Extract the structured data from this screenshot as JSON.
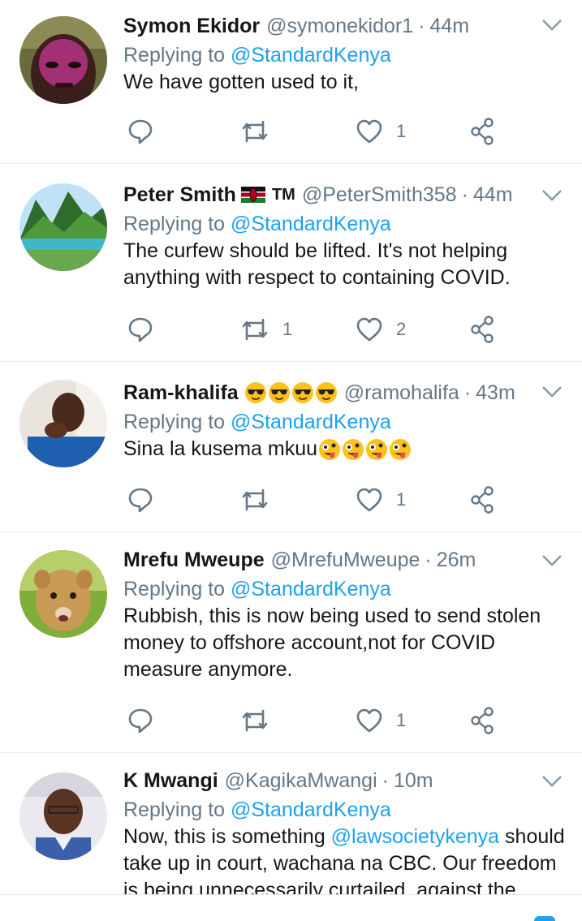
{
  "reply_prefix": "Replying to",
  "tweets": [
    {
      "name": "Symon Ekidor",
      "handle": "@symonekidor1",
      "separator": "·",
      "time": "44m",
      "reply_to": "@StandardKenya",
      "text": "We have gotten used to it,",
      "reply_count": "",
      "retweet_count": "",
      "like_count": "1",
      "avatar": "portrait-dark-face"
    },
    {
      "name": "Peter Smith",
      "badge": "kenya-flag-emoji",
      "tm": "TM",
      "handle": "@PeterSmith358",
      "separator": "·",
      "time": "44m",
      "reply_to": "@StandardKenya",
      "text": "The curfew should be lifted. It's not helping anything with respect to containing COVID.",
      "reply_count": "",
      "retweet_count": "1",
      "like_count": "2",
      "avatar": "mountain-lake-landscape"
    },
    {
      "name": "Ram-khalifa",
      "badge": "sunglasses-emoji x4",
      "handle": "@ramohalifa",
      "separator": "·",
      "time": "43m",
      "reply_to": "@StandardKenya",
      "text": "Sina la kusema mkuu",
      "text_emoji": "zany-face-emoji x4",
      "reply_count": "",
      "retweet_count": "",
      "like_count": "1",
      "avatar": "man-blue-shirt"
    },
    {
      "name": "Mrefu Mweupe",
      "handle": "@MrefuMweupe",
      "separator": "·",
      "time": "26m",
      "reply_to": "@StandardKenya",
      "text": "Rubbish, this is now being used to send stolen money to offshore account,not for COVID measure anymore.",
      "reply_count": "",
      "retweet_count": "",
      "like_count": "1",
      "avatar": "lion-cub"
    },
    {
      "name": "K Mwangi",
      "handle": "@KagikaMwangi",
      "separator": "·",
      "time": "10m",
      "reply_to": "@StandardKenya",
      "text_before": "Now, this is something ",
      "mention": "@lawsocietykenya",
      "text_after": " should take up in court, wachana na CBC. Our freedom is being unnecessarily curtailed, against the",
      "avatar": "man-glasses-indoor"
    }
  ],
  "colors": {
    "text": "#14171a",
    "secondary": "#657786",
    "link": "#1da1f2",
    "divider": "#e6ecf0"
  }
}
